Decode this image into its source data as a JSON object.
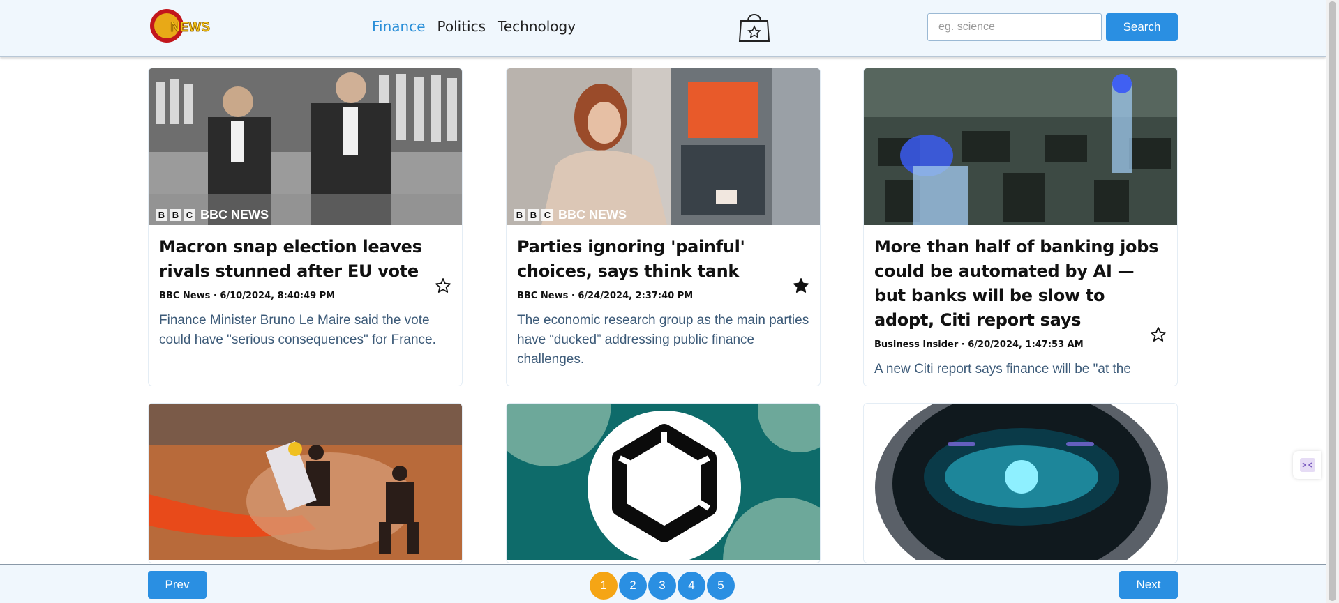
{
  "header": {
    "logo_text": "NEWS",
    "nav": [
      {
        "label": "Finance",
        "active": true
      },
      {
        "label": "Politics",
        "active": false
      },
      {
        "label": "Technology",
        "active": false
      }
    ],
    "bag_icon": "shopping-bag-star-icon",
    "search": {
      "placeholder": "eg. science",
      "value": "",
      "button_label": "Search"
    }
  },
  "articles": [
    {
      "title": "Macron snap election leaves rivals stunned after EU vote",
      "meta": "BBC News · 6/10/2024, 8:40:49 PM",
      "description": "Finance Minister Bruno Le Maire said the vote could have \"serious consequences\" for France.",
      "starred": false,
      "image_badge": "BBC NEWS"
    },
    {
      "title": "Parties ignoring 'painful' choices, says think tank",
      "meta": "BBC News · 6/24/2024, 2:37:40 PM",
      "description": "The economic research group as the main parties have “ducked” addressing public finance challenges.",
      "starred": true,
      "image_badge": "BBC NEWS"
    },
    {
      "title": "More than half of banking jobs could be automated by AI — but banks will be slow to adopt, Citi report says",
      "meta": "Business Insider · 6/20/2024, 1:47:53 AM",
      "description": "A new Citi report says finance will be \"at the",
      "starred": false,
      "image_badge": ""
    }
  ],
  "pagination": {
    "prev_label": "Prev",
    "next_label": "Next",
    "pages": [
      "1",
      "2",
      "3",
      "4",
      "5"
    ],
    "current": "1"
  },
  "colors": {
    "accent": "#2a8fe2",
    "current_page": "#f5a515",
    "header_bg": "#f0f7fd"
  }
}
